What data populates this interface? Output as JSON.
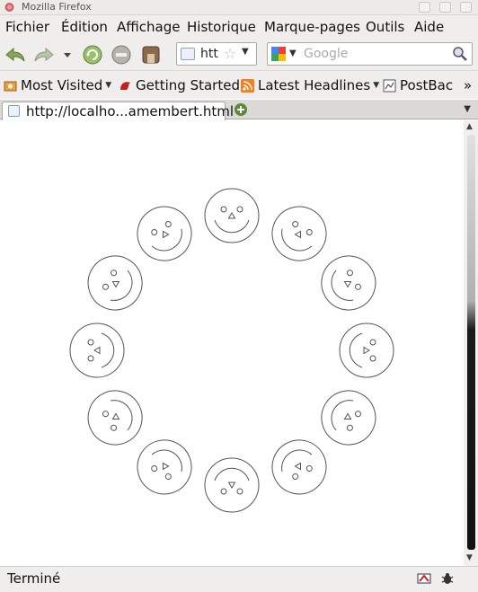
{
  "window": {
    "title": "Mozilla Firefox"
  },
  "menu": {
    "items": [
      "Fichier",
      "Édition",
      "Affichage",
      "Historique",
      "Marque-pages",
      "Outils",
      "Aide"
    ]
  },
  "navbar": {
    "url_text": "htt",
    "search_placeholder": "Google"
  },
  "bookmarks": {
    "items": [
      {
        "label": "Most Visited",
        "has_menu": true
      },
      {
        "label": "Getting Started",
        "has_menu": false
      },
      {
        "label": "Latest Headlines",
        "has_menu": true
      },
      {
        "label": "PostBac",
        "has_menu": false
      }
    ],
    "overflow": "»"
  },
  "tabs": [
    {
      "title": "http://localho...amembert.html"
    }
  ],
  "content": {
    "face_count": 12,
    "stroke_color": "#555555",
    "background": "#ffffff"
  },
  "statusbar": {
    "status": "Terminé"
  },
  "colors": {
    "chrome": "#efeeec",
    "accent": "#4a90c8"
  }
}
